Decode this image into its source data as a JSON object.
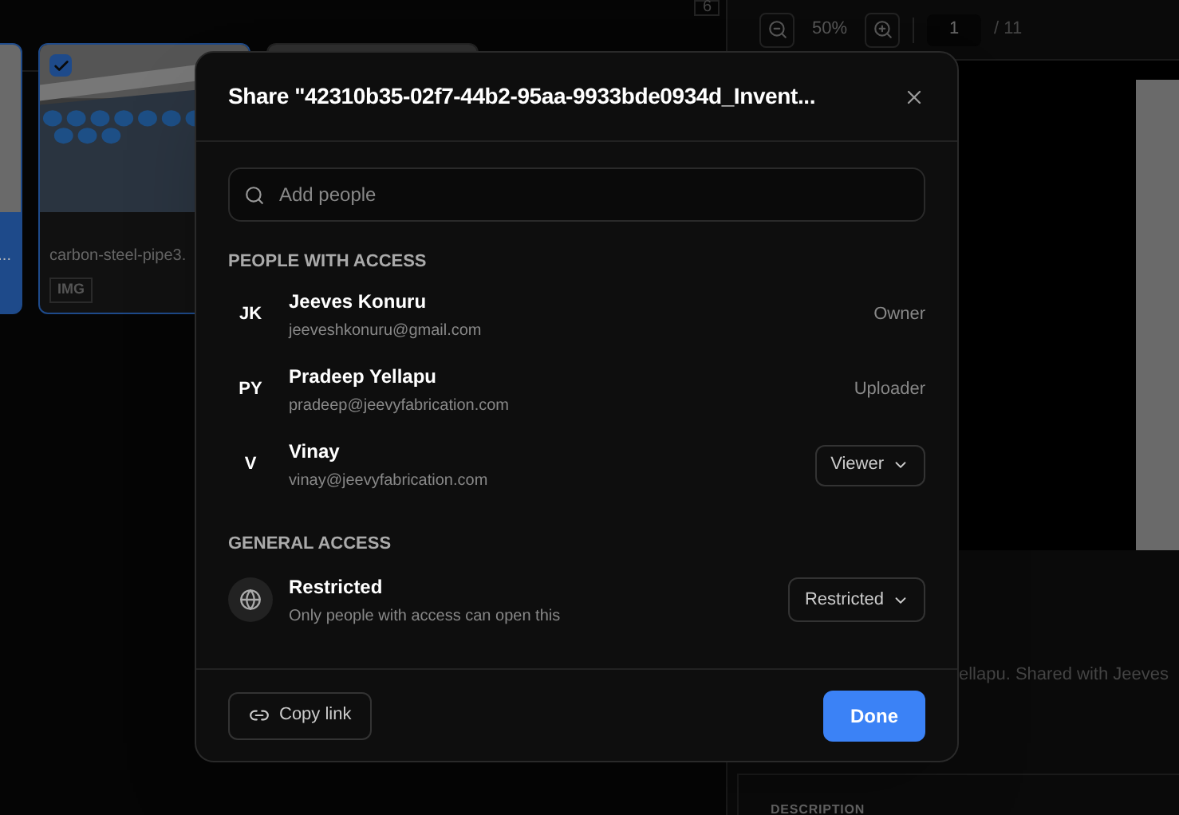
{
  "background": {
    "top_badge": "6",
    "thumbnails": [
      {
        "kind": "cut",
        "name": "...",
        "selected": true
      },
      {
        "kind": "pipes",
        "name": "carbon-steel-pipe3.",
        "badge": "IMG",
        "selected": true
      },
      {
        "kind": "sketch",
        "selected": false
      }
    ],
    "viewer": {
      "zoom": "50%",
      "page": "1",
      "page_count": "/ 11"
    },
    "details": {
      "shared_text": "ellapu. Shared with Jeeves",
      "description_heading": "DESCRIPTION"
    }
  },
  "dialog": {
    "title": "Share \"42310b35-02f7-44b2-95aa-9933bde0934d_Invent...",
    "search": {
      "placeholder": "Add people"
    },
    "people_heading": "PEOPLE WITH ACCESS",
    "people": [
      {
        "initials": "JK",
        "name": "Jeeves Konuru",
        "email": "jeeveshkonuru@gmail.com",
        "kind": "label",
        "role": "Owner"
      },
      {
        "initials": "PY",
        "name": "Pradeep Yellapu",
        "email": "pradeep@jeevyfabrication.com",
        "kind": "label",
        "role": "Uploader"
      },
      {
        "initials": "V",
        "name": "Vinay",
        "email": "vinay@jeevyfabrication.com",
        "kind": "dropdown",
        "role": "Viewer"
      }
    ],
    "general_heading": "GENERAL ACCESS",
    "general": {
      "title": "Restricted",
      "subtitle": "Only people with access can open this",
      "value": "Restricted"
    },
    "copy_link": "Copy link",
    "done": "Done"
  }
}
